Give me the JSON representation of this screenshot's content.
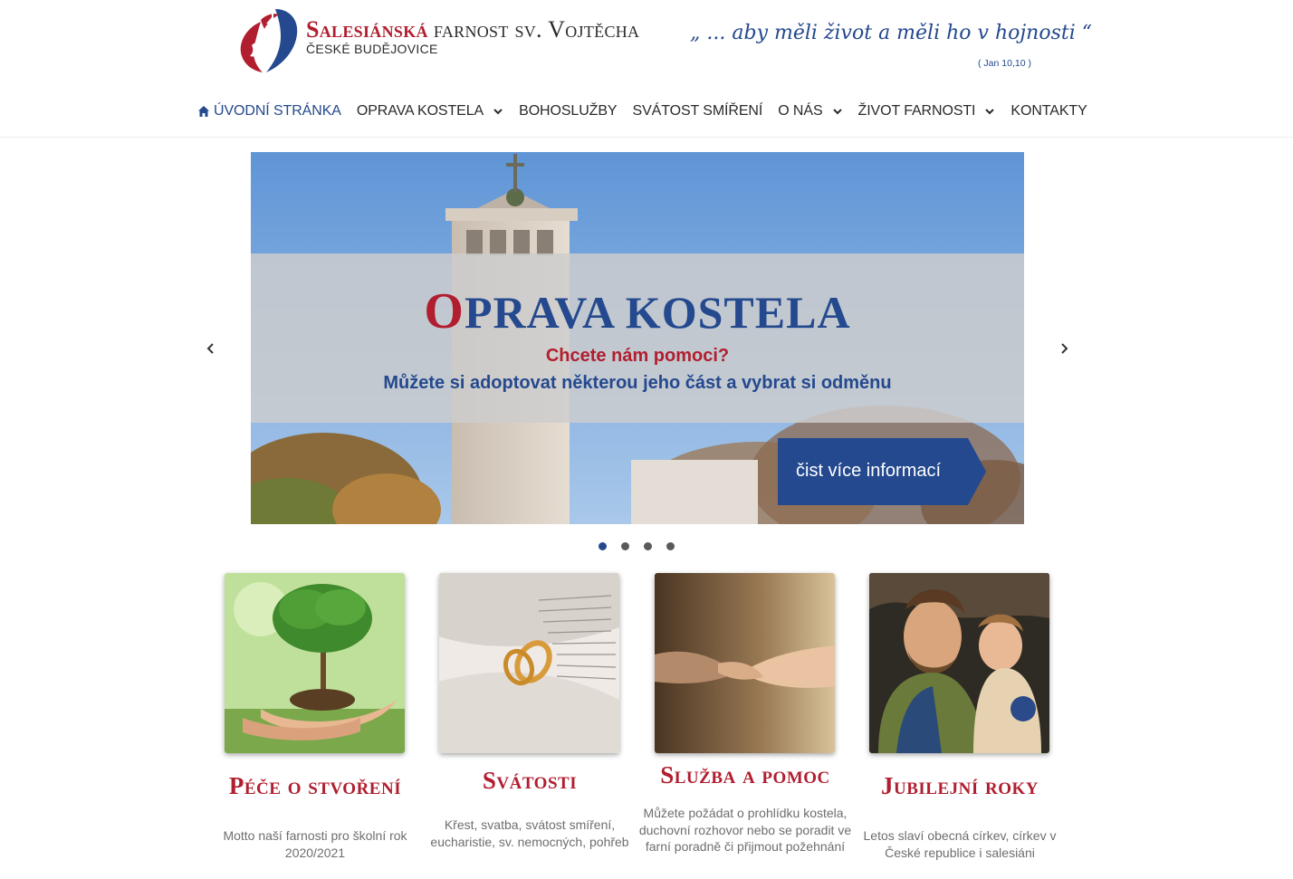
{
  "header": {
    "title_part1": "Salesiánská",
    "title_part2": "farnost sv. Vojtěcha",
    "subtitle": "ČESKÉ BUDĚJOVICE",
    "motto": "„ ... aby měli život a měli ho v hojnosti “",
    "motto_ref": "( Jan 10,10 )"
  },
  "nav": {
    "items": [
      {
        "label": "ÚVODNÍ STRÁNKA",
        "active": true,
        "icon": "home-icon"
      },
      {
        "label": "OPRAVA KOSTELA",
        "dropdown": true
      },
      {
        "label": "BOHOSLUŽBY"
      },
      {
        "label": "SVÁTOST SMÍŘENÍ"
      },
      {
        "label": "O NÁS",
        "dropdown": true
      },
      {
        "label": "ŽIVOT FARNOSTI",
        "dropdown": true
      },
      {
        "label": "KONTAKTY"
      }
    ]
  },
  "slider": {
    "title_first": "O",
    "title_rest": "PRAVA KOSTELA",
    "question": "Chcete nám pomoci?",
    "subtitle": "Můžete si adoptovat některou jeho část a vybrat si odměnu",
    "button": "čist více informací",
    "dot_count": 4,
    "active_dot": 1
  },
  "cards": [
    {
      "title": "Péče o stvoření",
      "desc": "Motto naší farnosti pro školní rok 2020/2021"
    },
    {
      "title": "Svátosti",
      "desc": "Křest, svatba, svátost smíření, eucharistie, sv. nemocných, pohřeb"
    },
    {
      "title": "Služba a pomoc",
      "desc": "Můžete požádat o prohlídku kostela, duchovní rozhovor nebo se poradit ve farní poradně či přijmout požehnání"
    },
    {
      "title": "Jubilejní roky",
      "desc": "Letos slaví obecná církev, církev v České republice i salesiáni"
    }
  ],
  "colors": {
    "brand_red": "#b11e2f",
    "brand_blue": "#24498e"
  }
}
